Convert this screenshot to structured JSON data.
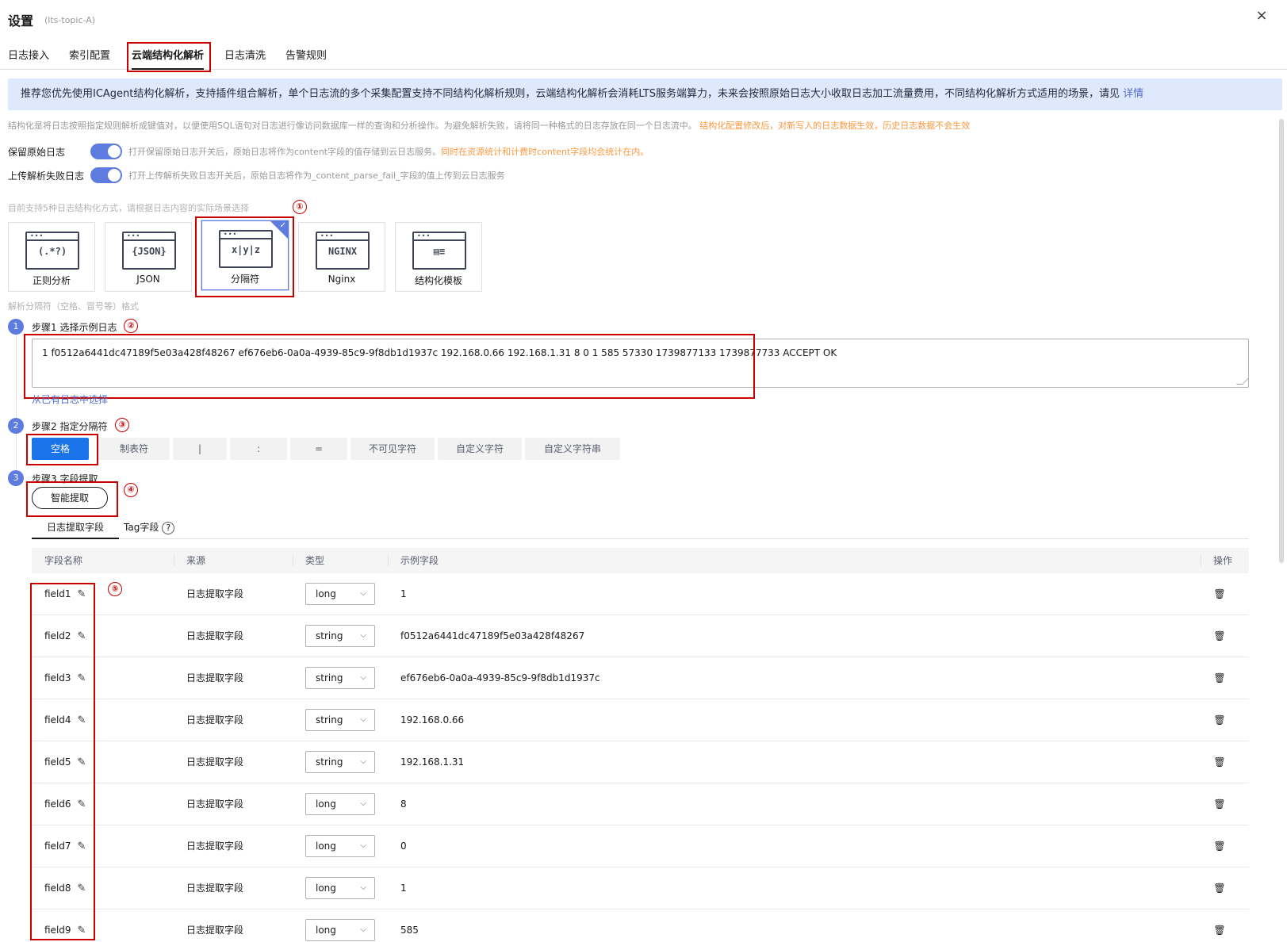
{
  "header": {
    "title": "设置",
    "subtitle": "(lts-topic-A)",
    "close": "×"
  },
  "tabs": [
    "日志接入",
    "索引配置",
    "云端结构化解析",
    "日志清洗",
    "告警规则"
  ],
  "banner": {
    "text": "推荐您优先使用ICAgent结构化解析，支持插件组合解析，单个日志流的多个采集配置支持不同结构化解析规则，云端结构化解析会消耗LTS服务端算力，未来会按照原始日志大小收取日志加工流量费用，不同结构化解析方式适用的场景，请见 ",
    "link": "详情"
  },
  "description": {
    "text": "结构化是将日志按照指定规则解析成键值对，以便使用SQL语句对日志进行像访问数据库一样的查询和分析操作。为避免解析失败，请将同一种格式的日志存放在同一个日志流中。",
    "warning": "结构化配置修改后，对新写入的日志数据生效，历史日志数据不会生效"
  },
  "switches": [
    {
      "label": "保留原始日志",
      "hint": "打开保留原始日志开关后，原始日志将作为content字段的值存储到云日志服务。",
      "warning": "同时在资源统计和计费时content字段均会统计在内。"
    },
    {
      "label": "上传解析失败日志",
      "hint": "打开上传解析失败日志开关后，原始日志将作为_content_parse_fail_字段的值上传到云日志服务",
      "warning": ""
    }
  ],
  "mode_hint": "目前支持5种日志结构化方式，请根据日志内容的实际场景选择",
  "modes": [
    {
      "label": "正则分析",
      "glyph": "(.*?)",
      "icon": "regex-icon"
    },
    {
      "label": "JSON",
      "glyph": "{JSON}",
      "icon": "json-icon"
    },
    {
      "label": "分隔符",
      "glyph": "x|y|z",
      "icon": "delimiter-icon",
      "selected": true
    },
    {
      "label": "Nginx",
      "glyph": "NGINX",
      "icon": "nginx-icon"
    },
    {
      "label": "结构化模板",
      "glyph": "▤≡",
      "icon": "template-icon"
    }
  ],
  "separator_hint": "解析分隔符（空格、冒号等）格式",
  "markers": [
    "①",
    "②",
    "③",
    "④",
    "⑤"
  ],
  "steps": [
    {
      "num": "1",
      "title": "步骤1 选择示例日志"
    },
    {
      "num": "2",
      "title": "步骤2 指定分隔符"
    },
    {
      "num": "3",
      "title": "步骤3 字段提取"
    }
  ],
  "sample_log": "1 f0512a6441dc47189f5e03a428f48267 ef676eb6-0a0a-4939-85c9-9f8db1d1937c 192.168.0.66 192.168.1.31 8 0 1 585 57330 1739877133 1739877733 ACCEPT OK",
  "pick_link": "从已有日志中选择",
  "separators": [
    "空格",
    "制表符",
    "|",
    ":",
    "=",
    "不可见字符",
    "自定义字符",
    "自定义字符串"
  ],
  "smart_extract": "智能提取",
  "subtabs": {
    "log_fields": "日志提取字段",
    "tag_fields": "Tag字段"
  },
  "table": {
    "headers": {
      "name": "字段名称",
      "source": "来源",
      "type": "类型",
      "example": "示例字段",
      "action": "操作"
    },
    "rows": [
      {
        "name": "field1",
        "source": "日志提取字段",
        "type": "long",
        "example": "1"
      },
      {
        "name": "field2",
        "source": "日志提取字段",
        "type": "string",
        "example": "f0512a6441dc47189f5e03a428f48267"
      },
      {
        "name": "field3",
        "source": "日志提取字段",
        "type": "string",
        "example": "ef676eb6-0a0a-4939-85c9-9f8db1d1937c"
      },
      {
        "name": "field4",
        "source": "日志提取字段",
        "type": "string",
        "example": "192.168.0.66"
      },
      {
        "name": "field5",
        "source": "日志提取字段",
        "type": "string",
        "example": "192.168.1.31"
      },
      {
        "name": "field6",
        "source": "日志提取字段",
        "type": "long",
        "example": "8"
      },
      {
        "name": "field7",
        "source": "日志提取字段",
        "type": "long",
        "example": "0"
      },
      {
        "name": "field8",
        "source": "日志提取字段",
        "type": "long",
        "example": "1"
      },
      {
        "name": "field9",
        "source": "日志提取字段",
        "type": "long",
        "example": "585"
      }
    ]
  },
  "colors": {
    "accent": "#5e7ce0",
    "primary_button": "#1a73e8",
    "annotation": "#cc0000",
    "warning": "#fa9841",
    "banner_bg": "#dee9fd"
  }
}
